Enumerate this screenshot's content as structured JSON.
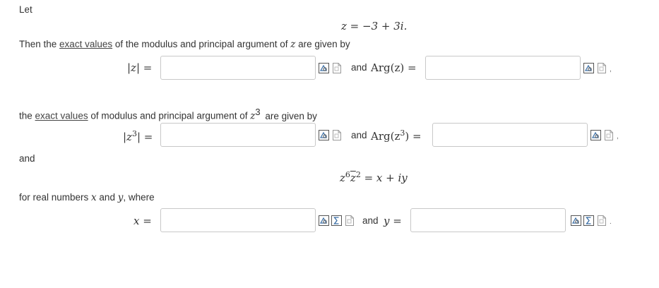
{
  "intro": {
    "let": "Let",
    "z_def": "z = −3 + 3i."
  },
  "q1": {
    "text_before": "Then the ",
    "link": "exact values",
    "text_after": " of the modulus and principal argument of ",
    "var": "z",
    "text_end": " are given by",
    "modulus_label": "|z| =",
    "and_label": "and",
    "arg_label": "Arg(z) =",
    "modulus_value": "",
    "arg_value": "",
    "trail": ","
  },
  "q2": {
    "text_before": "the ",
    "link": "exact values",
    "text_after": " of modulus and principal argument of ",
    "var": "z",
    "sup": "3",
    "text_end": " are given by",
    "modulus_label_pre": "|z",
    "modulus_label_sup": "3",
    "modulus_label_post": "| =",
    "and_label": "and",
    "arg_label_pre": "Arg(z",
    "arg_label_sup": "3",
    "arg_label_post": ") =",
    "modulus_value": "",
    "arg_value": "",
    "trail": ","
  },
  "q3": {
    "and_text": "and",
    "eq_z": "z",
    "eq_sup1": "6",
    "eq_zbar": "z",
    "eq_sup2": "2",
    "eq_rest": " = x + iy",
    "for_text_1": "for real numbers ",
    "for_x": "x",
    "for_and": " and ",
    "for_y": "y",
    "for_where": ", where",
    "x_label": "x =",
    "and_label": "and",
    "y_label": "y =",
    "x_value": "",
    "y_value": "",
    "trail": "."
  },
  "icons": {
    "preview": "preview-icon",
    "sigma": "sigma-icon",
    "help": "help-icon"
  },
  "colors": {
    "icon_outline": "#555555",
    "icon_accent": "#3a6ea5",
    "field_border": "#c8c8c8"
  }
}
